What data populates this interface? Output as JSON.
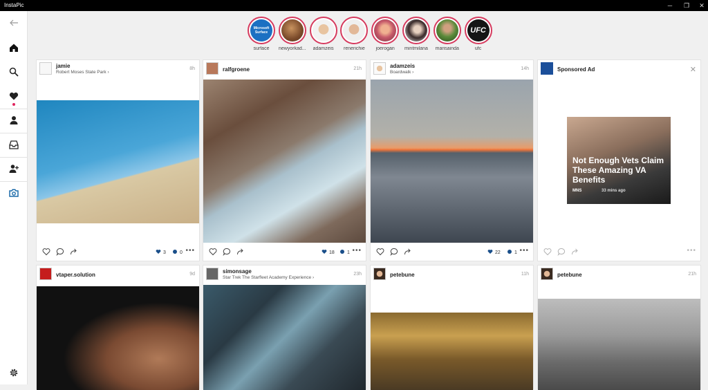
{
  "window": {
    "title": "InstaPic",
    "controls": [
      "─",
      "❐",
      "✕"
    ]
  },
  "sidebar": {
    "items": [
      {
        "name": "back",
        "icon": "back-arrow-icon"
      },
      {
        "name": "home",
        "icon": "home-icon"
      },
      {
        "name": "search",
        "icon": "search-icon"
      },
      {
        "name": "activity",
        "icon": "heart-icon"
      },
      {
        "name": "profile",
        "icon": "person-icon"
      },
      {
        "name": "inbox",
        "icon": "inbox-icon"
      },
      {
        "name": "add-user",
        "icon": "add-person-icon"
      },
      {
        "name": "camera",
        "icon": "camera-icon"
      },
      {
        "name": "settings",
        "icon": "gear-icon"
      }
    ],
    "accent": "#1a6aa8",
    "notification_color": "#e0245e"
  },
  "stories": [
    {
      "name": "surface",
      "label": "Microsoft Surface"
    },
    {
      "name": "newyorkad..."
    },
    {
      "name": "adamzeis"
    },
    {
      "name": "renerichie"
    },
    {
      "name": "joerogan"
    },
    {
      "name": "mintmilana"
    },
    {
      "name": "marisainda"
    },
    {
      "name": "ufc",
      "label": "UFC"
    }
  ],
  "posts": [
    {
      "user": "jamie",
      "location": "Robert Moses State Park",
      "time": "8h",
      "likes": "3",
      "comments": "0"
    },
    {
      "user": "ralfgroene",
      "location": "",
      "time": "21h",
      "likes": "18",
      "comments": "1"
    },
    {
      "user": "adamzeis",
      "location": "Boardwalk",
      "time": "14h",
      "likes": "22",
      "comments": "1"
    },
    {
      "user": "vtaper.solution",
      "location": "",
      "time": "9d"
    },
    {
      "user": "simonsage",
      "location": "Star Trek The Starfleet Academy Experience",
      "time": "23h"
    },
    {
      "user": "petebune",
      "location": "",
      "time": "11h"
    },
    {
      "user": "petebune",
      "location": "",
      "time": "21h"
    }
  ],
  "sponsored": {
    "label": "Sponsored Ad",
    "headline": "Not Enough Vets Claim These Amazing VA Benefits",
    "source": "MNS",
    "ago": "33 mins ago"
  },
  "story_ring_color": "#d63a5e"
}
